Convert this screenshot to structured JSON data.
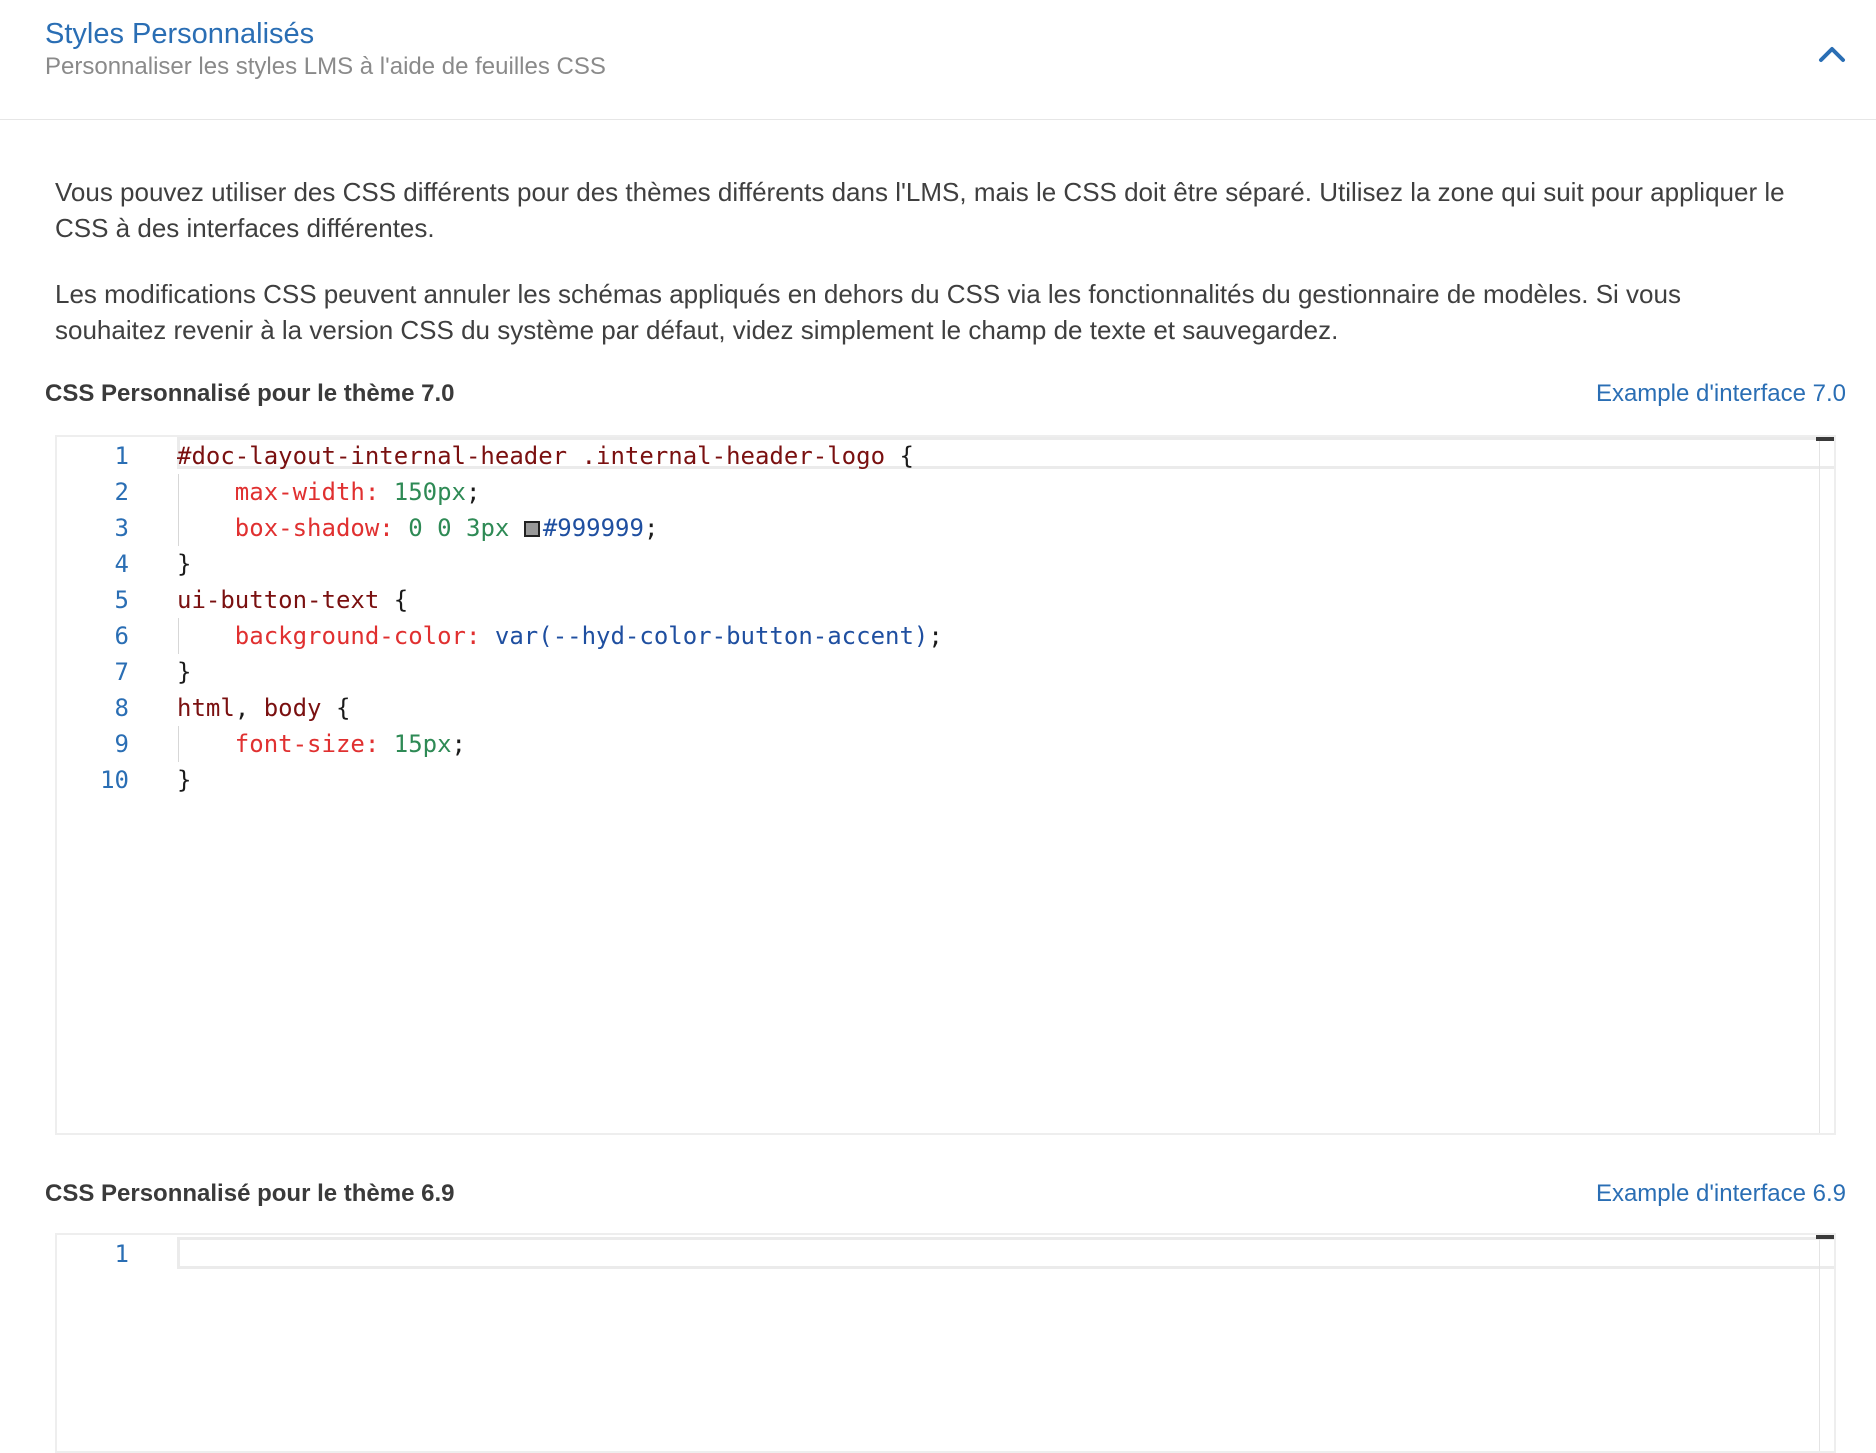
{
  "panel": {
    "title": "Styles Personnalisés",
    "subtitle": "Personnaliser les styles LMS à l'aide de feuilles CSS",
    "collapse_icon": "chevron-up-icon",
    "accent_color": "#2a6eb4"
  },
  "description": {
    "paragraph1": "Vous pouvez utiliser des CSS différents pour des thèmes différents dans l'LMS, mais le CSS doit être séparé. Utilisez la zone qui suit pour appliquer le CSS à des interfaces différentes.",
    "paragraph2": "Les modifications CSS peuvent annuler les schémas appliqués en dehors du CSS via les fonctionnalités du gestionnaire de modèles. Si vous souhaitez revenir à la version CSS du système par défaut, videz simplement le champ de texte et sauvegardez."
  },
  "theme70": {
    "label": "CSS Personnalisé pour le thème 7.0",
    "example_link": "Example d'interface 7.0",
    "line_numbers": [
      "1",
      "2",
      "3",
      "4",
      "5",
      "6",
      "7",
      "8",
      "9",
      "10"
    ],
    "lines": [
      [
        {
          "t": "#doc-layout-internal-header .internal-header-logo",
          "c": "selector"
        },
        {
          "t": " {",
          "c": "punc"
        }
      ],
      [
        {
          "t": "    "
        },
        {
          "t": "max-width:",
          "c": "prop"
        },
        {
          "t": " "
        },
        {
          "t": "150px",
          "c": "num"
        },
        {
          "t": ";",
          "c": "punc"
        }
      ],
      [
        {
          "t": "    "
        },
        {
          "t": "box-shadow:",
          "c": "prop"
        },
        {
          "t": " "
        },
        {
          "t": "0 0 3px",
          "c": "num"
        },
        {
          "t": " "
        },
        {
          "swatch": "#999999"
        },
        {
          "t": "#999999",
          "c": "var"
        },
        {
          "t": ";",
          "c": "punc"
        }
      ],
      [
        {
          "t": "}",
          "c": "punc"
        }
      ],
      [
        {
          "t": "ui-button-text",
          "c": "selector"
        },
        {
          "t": " {",
          "c": "punc"
        }
      ],
      [
        {
          "t": "    "
        },
        {
          "t": "background-color:",
          "c": "prop"
        },
        {
          "t": " "
        },
        {
          "t": "var(--hyd-color-button-accent)",
          "c": "var"
        },
        {
          "t": ";",
          "c": "punc"
        }
      ],
      [
        {
          "t": "}",
          "c": "punc"
        }
      ],
      [
        {
          "t": "html",
          "c": "selector"
        },
        {
          "t": ", ",
          "c": "punc"
        },
        {
          "t": "body",
          "c": "selector"
        },
        {
          "t": " {",
          "c": "punc"
        }
      ],
      [
        {
          "t": "    "
        },
        {
          "t": "font-size:",
          "c": "prop"
        },
        {
          "t": " "
        },
        {
          "t": "15px",
          "c": "num"
        },
        {
          "t": ";",
          "c": "punc"
        }
      ],
      [
        {
          "t": "}",
          "c": "punc"
        }
      ]
    ]
  },
  "theme69": {
    "label": "CSS Personnalisé pour le thème 6.9",
    "example_link": "Example d'interface 6.9",
    "line_numbers": [
      "1"
    ],
    "lines": [
      []
    ]
  }
}
